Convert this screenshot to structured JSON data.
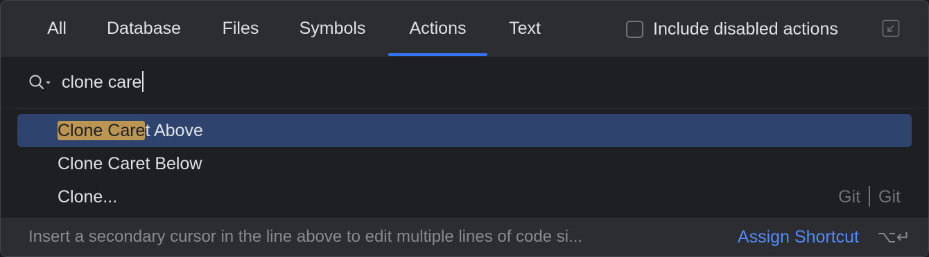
{
  "tabs": [
    {
      "label": "All"
    },
    {
      "label": "Database"
    },
    {
      "label": "Files"
    },
    {
      "label": "Symbols"
    },
    {
      "label": "Actions",
      "active": true
    },
    {
      "label": "Text"
    }
  ],
  "include_disabled": {
    "label": "Include disabled actions",
    "checked": false
  },
  "search": {
    "value": "clone care"
  },
  "results": [
    {
      "match": "Clone Care",
      "rest": "t Above",
      "selected": true
    },
    {
      "match": "",
      "rest": "Clone Caret Below"
    },
    {
      "match": "",
      "rest": "Clone...",
      "right_left": "Git",
      "right_right": "Git"
    }
  ],
  "footer": {
    "hint": "Insert a secondary cursor in the line above to edit multiple lines of code si...",
    "assign_label": "Assign Shortcut",
    "keys": "⌥↵"
  },
  "colors": {
    "accent": "#3574f0",
    "selection": "#2e436e",
    "match_highlight": "#bb9552",
    "link": "#548af7"
  }
}
